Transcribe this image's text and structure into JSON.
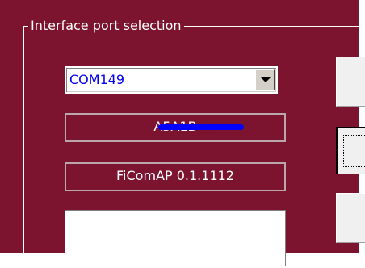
{
  "window": {
    "background_color": "#7c1430"
  },
  "group": {
    "title": "Interface port selection"
  },
  "port_combo": {
    "value": "COM149"
  },
  "serial_field": {
    "value": "A5A1B"
  },
  "version_field": {
    "value": "FiComAP 0.1.1112"
  },
  "icons": {
    "dropdown": "chevron-down-icon"
  }
}
